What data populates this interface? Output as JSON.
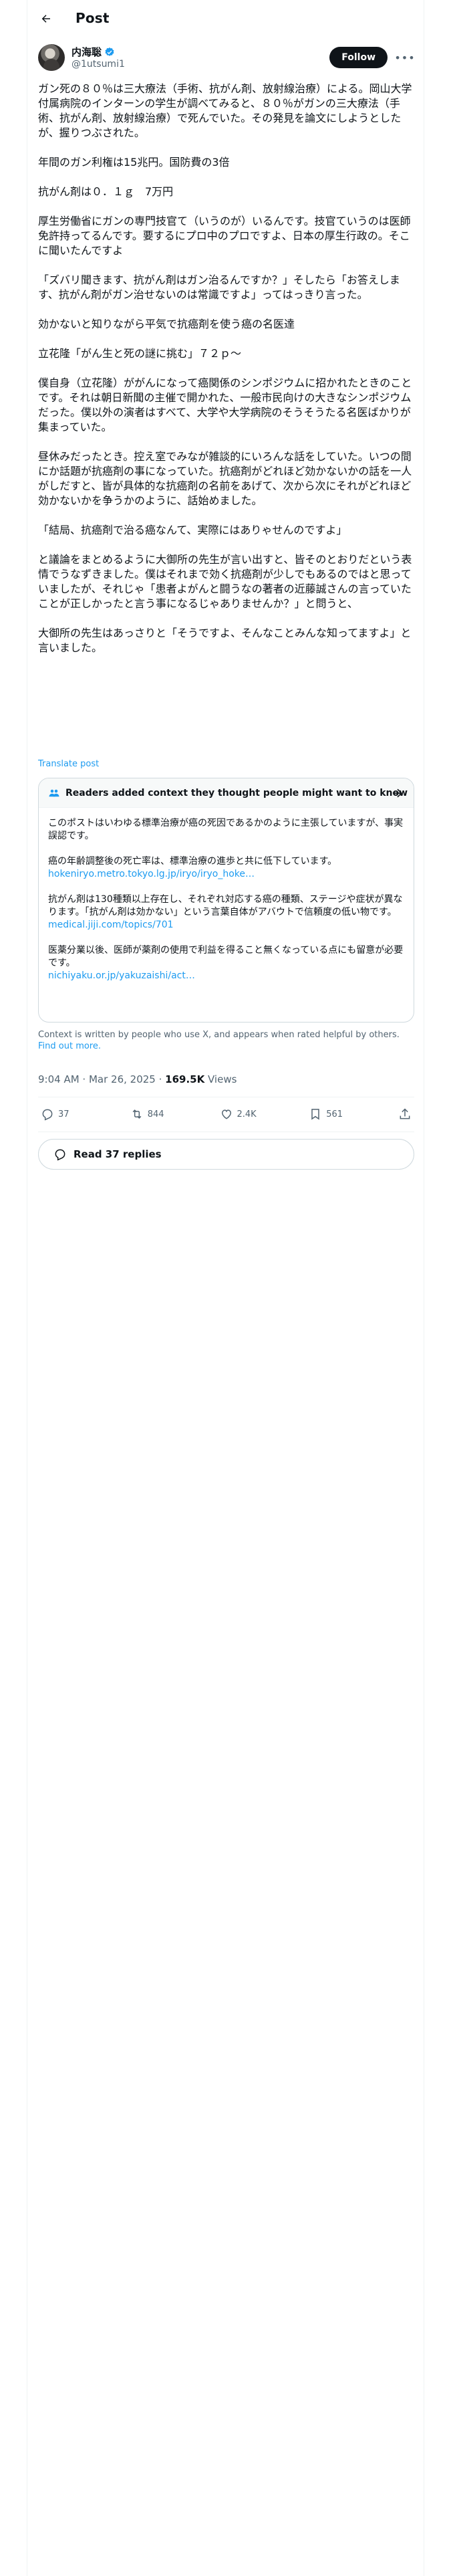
{
  "header": {
    "title": "Post"
  },
  "author": {
    "name": "内海聡",
    "handle": "@1utsumi1"
  },
  "buttons": {
    "follow": "Follow"
  },
  "tweet": {
    "paragraphs": [
      "ガン死の８０％は三大療法（手術、抗がん剤、放射線治療）による。岡山大学付属病院のインターンの学生が調べてみると、８０％がガンの三大療法（手術、抗がん剤、放射線治療）で死んでいた。その発見を論文にしようとしたが、握りつぶされた。",
      "年間のガン利権は15兆円。国防費の3倍",
      "抗がん剤は０．１ｇ　7万円",
      "厚生労働省にガンの専門技官て（いうのが）いるんです。技官ていうのは医師免許持ってるんです。要するにプロ中のプロですよ、日本の厚生行政の。そこに聞いたんですよ",
      "「ズバリ聞きます、抗がん剤はガン治るんですか？」そしたら「お答えします、抗がん剤がガン治せないのは常識ですよ」ってはっきり言った。",
      "効かないと知りながら平気で抗癌剤を使う癌の名医達",
      "立花隆「がん生と死の謎に挑む」７２ｐ〜",
      "僕自身（立花隆）ががんになって癌関係のシンポジウムに招かれたときのことです。それは朝日新聞の主催で開かれた、一般市民向けの大きなシンポジウムだった。僕以外の演者はすべて、大学や大学病院のそうそうたる名医ばかりが集まっていた。",
      "昼休みだったとき。控え室でみなが雑談的にいろんな話をしていた。いつの間にか話題が抗癌剤の事になっていた。抗癌剤がどれほど効かないかの話を一人がしだすと、皆が具体的な抗癌剤の名前をあげて、次から次にそれがどれほど効かないかを争うかのように、話始めました。",
      "「結局、抗癌剤で治る癌なんて、実際にはありゃせんのですよ」",
      "と議論をまとめるように大御所の先生が言い出すと、皆そのとおりだという表情でうなずきました。僕はそれまで効く抗癌剤が少しでもあるのではと思っていましたが、それじゃ「患者よがんと闘うなの著者の近藤誠さんの言っていたことが正しかったと言う事になるじゃありませんか？」と問うと、",
      "大御所の先生はあっさりと「そうですよ、そんなことみんな知ってますよ」と言いました。"
    ]
  },
  "translate_label": "Translate post",
  "community_note": {
    "title": "Readers added context they thought people might want to know",
    "items": [
      {
        "text": "このポストはいわゆる標準治療が癌の死因であるかのように主張していますが、事実誤認です。",
        "link": ""
      },
      {
        "text": "癌の年齢調整後の死亡率は、標準治療の進歩と共に低下しています。",
        "link": "hokeniryo.metro.tokyo.lg.jp/iryo/iryo_hoke…"
      },
      {
        "text": "抗がん剤は130種類以上存在し、それぞれ対応する癌の種類、ステージや症状が異なります。「抗がん剤は効かない」という言葉自体がアバウトで信頼度の低い物です。",
        "link": "medical.jiji.com/topics/701"
      },
      {
        "text": "医薬分業以後、医師が薬剤の使用で利益を得ること無くなっている点にも留意が必要です。",
        "link": "nichiyaku.or.jp/yakuzaishi/act…"
      }
    ],
    "footer_text": "Context is written by people who use X, and appears when rated helpful by others.",
    "footer_link": "Find out more."
  },
  "meta": {
    "time": "9:04 AM · Mar 26, 2025 · ",
    "views_count": "169.5K",
    "views_label": "Views"
  },
  "actions": {
    "replies": "37",
    "reposts": "844",
    "likes": "2.4K",
    "bookmarks": "561"
  },
  "read_replies": "Read 37 replies",
  "colors": {
    "accent": "#1d9bf0",
    "text": "#0f1419",
    "secondary": "#536471",
    "border": "#cfd9de"
  },
  "icons": [
    "back-arrow-icon",
    "verified-badge-icon",
    "more-icon",
    "community-notes-icon",
    "arrow-right-icon",
    "reply-icon",
    "repost-icon",
    "like-icon",
    "bookmark-icon",
    "share-icon",
    "replies-bubble-icon"
  ]
}
